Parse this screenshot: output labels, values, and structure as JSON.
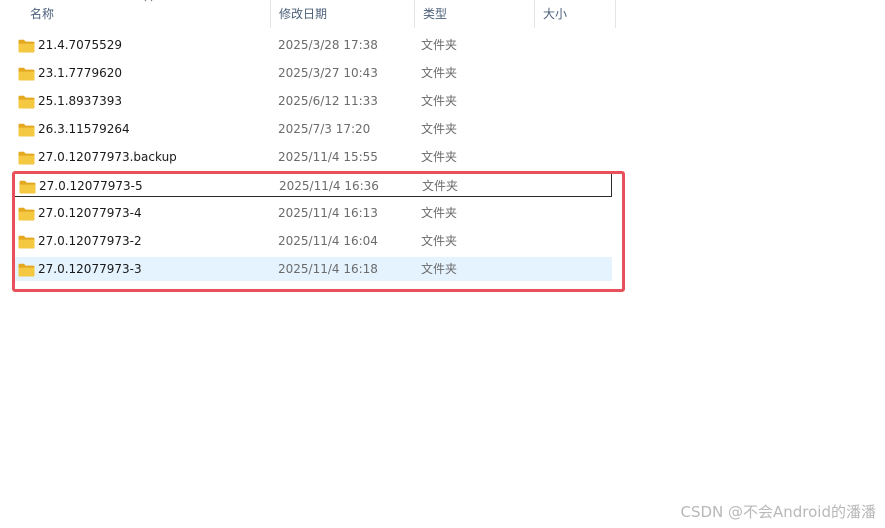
{
  "header": {
    "columns": [
      {
        "key": "name",
        "label": "名称",
        "sorted": "ascending"
      },
      {
        "key": "modified",
        "label": "修改日期"
      },
      {
        "key": "type",
        "label": "类型"
      },
      {
        "key": "size",
        "label": "大小"
      }
    ]
  },
  "files": [
    {
      "name": "21.4.7075529",
      "modified": "2025/3/28 17:38",
      "type": "文件夹",
      "size": ""
    },
    {
      "name": "23.1.7779620",
      "modified": "2025/3/27 10:43",
      "type": "文件夹",
      "size": ""
    },
    {
      "name": "25.1.8937393",
      "modified": "2025/6/12 11:33",
      "type": "文件夹",
      "size": ""
    },
    {
      "name": "26.3.11579264",
      "modified": "2025/7/3 17:20",
      "type": "文件夹",
      "size": ""
    },
    {
      "name": "27.0.12077973.backup",
      "modified": "2025/11/4 15:55",
      "type": "文件夹",
      "size": ""
    },
    {
      "name": "27.0.12077973-5",
      "modified": "2025/11/4 16:36",
      "type": "文件夹",
      "size": "",
      "state": "focused"
    },
    {
      "name": "27.0.12077973-4",
      "modified": "2025/11/4 16:13",
      "type": "文件夹",
      "size": ""
    },
    {
      "name": "27.0.12077973-2",
      "modified": "2025/11/4 16:04",
      "type": "文件夹",
      "size": ""
    },
    {
      "name": "27.0.12077973-3",
      "modified": "2025/11/4 16:18",
      "type": "文件夹",
      "size": "",
      "state": "hovered"
    }
  ],
  "annotation": {
    "color": "#e8505b",
    "covers_rows": [
      5,
      6,
      7,
      8
    ]
  },
  "folder_color": "#f5c842",
  "watermark": "CSDN @不会Android的潘潘"
}
